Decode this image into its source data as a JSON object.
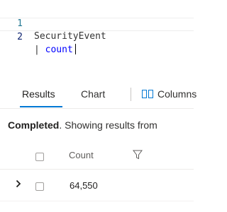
{
  "editor": {
    "lines": [
      {
        "number": "1",
        "table": "SecurityEvent"
      },
      {
        "number": "2",
        "pipe": "| ",
        "operator": "count"
      }
    ]
  },
  "tabs": {
    "results_label": "Results",
    "chart_label": "Chart",
    "columns_label": "Columns"
  },
  "status": {
    "bold": "Completed",
    "rest": ". Showing results from"
  },
  "grid": {
    "column_header": "Count",
    "rows": [
      {
        "count": "64,550"
      }
    ]
  },
  "colors": {
    "accent": "#0078d4",
    "keyword": "#0000ff"
  }
}
